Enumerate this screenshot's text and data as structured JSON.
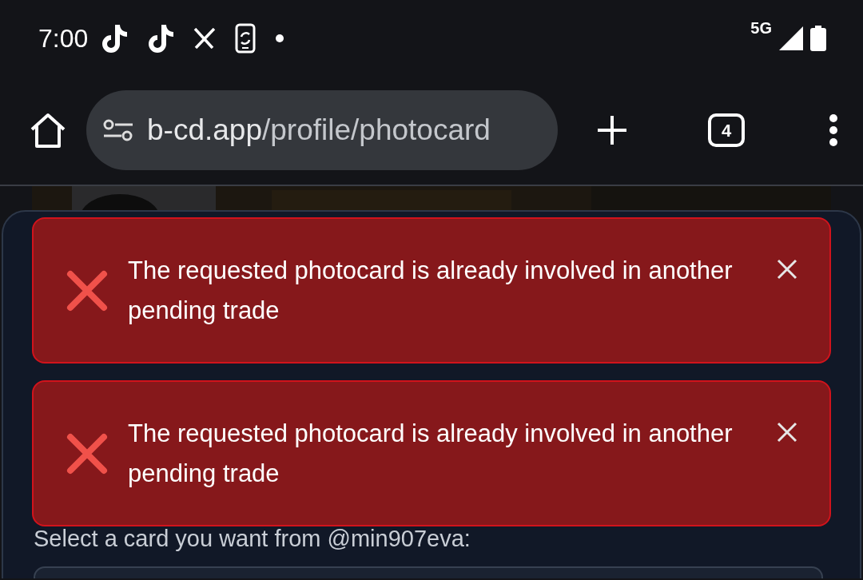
{
  "status_bar": {
    "time": "7:00",
    "network": "5G"
  },
  "browser": {
    "url_host": "b-cd.app",
    "url_path": "/profile/photocard",
    "tab_count": "4"
  },
  "toasts": [
    {
      "kind": "error",
      "message": "The requested photocard is already involved in another pending trade"
    },
    {
      "kind": "error",
      "message": "The requested photocard is already involved in another pending trade"
    }
  ],
  "form": {
    "label": "Select a card you want from @min907eva:"
  }
}
